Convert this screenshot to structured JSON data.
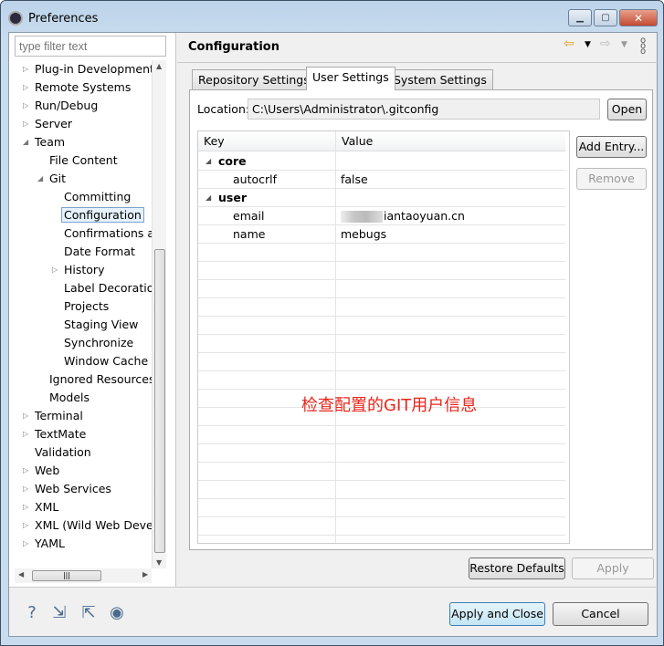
{
  "window": {
    "title": "Preferences",
    "minimize": "▁",
    "maximize": "▢",
    "close": "✕"
  },
  "filter": {
    "placeholder": "type filter text"
  },
  "tree": [
    {
      "label": "Plug-in Development",
      "level": 0,
      "state": "collapsed"
    },
    {
      "label": "Remote Systems",
      "level": 0,
      "state": "collapsed"
    },
    {
      "label": "Run/Debug",
      "level": 0,
      "state": "collapsed"
    },
    {
      "label": "Server",
      "level": 0,
      "state": "collapsed"
    },
    {
      "label": "Team",
      "level": 0,
      "state": "expanded"
    },
    {
      "label": "File Content",
      "level": 1,
      "state": "leaf"
    },
    {
      "label": "Git",
      "level": 1,
      "state": "expanded"
    },
    {
      "label": "Committing",
      "level": 2,
      "state": "leaf"
    },
    {
      "label": "Configuration",
      "level": 2,
      "state": "leaf",
      "selected": true
    },
    {
      "label": "Confirmations ar",
      "level": 2,
      "state": "leaf"
    },
    {
      "label": "Date Format",
      "level": 2,
      "state": "leaf"
    },
    {
      "label": "History",
      "level": 2,
      "state": "collapsed"
    },
    {
      "label": "Label Decoratio",
      "level": 2,
      "state": "leaf"
    },
    {
      "label": "Projects",
      "level": 2,
      "state": "leaf"
    },
    {
      "label": "Staging View",
      "level": 2,
      "state": "leaf"
    },
    {
      "label": "Synchronize",
      "level": 2,
      "state": "leaf"
    },
    {
      "label": "Window Cache",
      "level": 2,
      "state": "leaf"
    },
    {
      "label": "Ignored Resources",
      "level": 1,
      "state": "leaf"
    },
    {
      "label": "Models",
      "level": 1,
      "state": "leaf"
    },
    {
      "label": "Terminal",
      "level": 0,
      "state": "collapsed"
    },
    {
      "label": "TextMate",
      "level": 0,
      "state": "collapsed"
    },
    {
      "label": "Validation",
      "level": 0,
      "state": "leaf"
    },
    {
      "label": "Web",
      "level": 0,
      "state": "collapsed"
    },
    {
      "label": "Web Services",
      "level": 0,
      "state": "collapsed"
    },
    {
      "label": "XML",
      "level": 0,
      "state": "collapsed"
    },
    {
      "label": "XML (Wild Web Devel",
      "level": 0,
      "state": "collapsed"
    },
    {
      "label": "YAML",
      "level": 0,
      "state": "collapsed"
    }
  ],
  "page": {
    "title": "Configuration",
    "tabs": [
      {
        "label": "Repository Settings"
      },
      {
        "label": "User Settings",
        "active": true
      },
      {
        "label": "System Settings"
      }
    ],
    "location_label": "Location:",
    "location_value": "C:\\Users\\Administrator\\.gitconfig",
    "open": "Open",
    "add_entry": "Add Entry...",
    "remove": "Remove",
    "columns": [
      "Key",
      "Value"
    ],
    "rows": [
      {
        "key": "core",
        "value": "",
        "section": true
      },
      {
        "key": "autocrlf",
        "value": "false"
      },
      {
        "key": "user",
        "value": "",
        "section": true
      },
      {
        "key": "email",
        "value": "iantaoyuan.cn",
        "redacted": true
      },
      {
        "key": "name",
        "value": "mebugs"
      }
    ],
    "annotation": "检查配置的GIT用户信息",
    "restore_defaults": "Restore Defaults",
    "apply": "Apply"
  },
  "footer": {
    "apply_close": "Apply and Close",
    "cancel": "Cancel",
    "icons": [
      "help-icon",
      "import-icon",
      "export-icon",
      "record-icon"
    ]
  }
}
